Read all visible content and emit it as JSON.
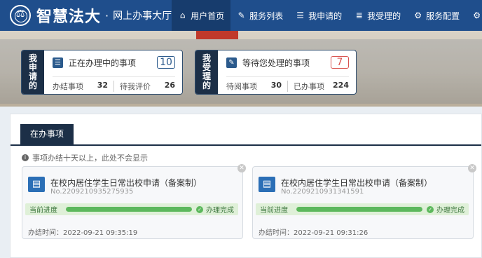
{
  "brand": {
    "title": "智慧法大",
    "dot": "·",
    "subtitle": "网上办事大厅"
  },
  "nav": [
    {
      "label": "用户首页",
      "icon": "home-icon",
      "glyph": "⌂"
    },
    {
      "label": "服务列表",
      "icon": "edit-icon",
      "glyph": "✎"
    },
    {
      "label": "我申请的",
      "icon": "list-icon",
      "glyph": "☰"
    },
    {
      "label": "我受理的",
      "icon": "list-icon",
      "glyph": "≣"
    },
    {
      "label": "服务配置",
      "icon": "gears-icon",
      "glyph": "⚙"
    }
  ],
  "settings_glyph": "⚙",
  "applied": {
    "side": [
      "我",
      "申",
      "请",
      "的"
    ],
    "title": "正在办理中的事项",
    "count": "10",
    "stats": [
      {
        "label": "办结事项",
        "value": "32"
      },
      {
        "label": "待我评价",
        "value": "26"
      }
    ]
  },
  "handled": {
    "side": [
      "我",
      "受",
      "理",
      "的"
    ],
    "title": "等待您处理的事项",
    "count": "7",
    "stats": [
      {
        "label": "待阅事项",
        "value": "30"
      },
      {
        "label": "已办事项",
        "value": "224"
      }
    ]
  },
  "tab": {
    "label": "在办事项"
  },
  "notice": "事项办结十天以上，此处不会显示",
  "tasks": [
    {
      "title": "在校内居住学生日常出校申请（备案制）",
      "no": "No.2209210935275935",
      "progress_label": "当前进度",
      "progress": 1.0,
      "status": "办理完成",
      "time": "办结时间：2022-09-21 09:35:19"
    },
    {
      "title": "在校内居住学生日常出校申请（备案制）",
      "no": "No.2209210931341591",
      "progress_label": "当前进度",
      "progress": 1.0,
      "status": "办理完成",
      "time": "办结时间：2022-09-21 09:31:26"
    }
  ],
  "colors": {
    "nav_bg": "#1f4e8c",
    "nav_active": "#173c6d",
    "side_bg": "#1c2f47",
    "progress": "#5cb85c",
    "count_red": "#d9534f"
  }
}
